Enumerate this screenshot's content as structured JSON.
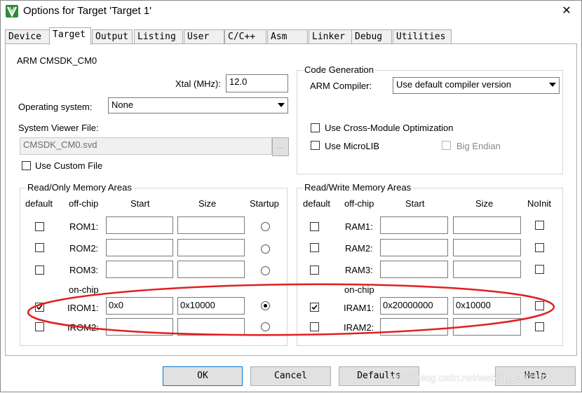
{
  "window": {
    "title": "Options for Target 'Target 1'",
    "close_glyph": "✕"
  },
  "tabs": [
    "Device",
    "Target",
    "Output",
    "Listing",
    "User",
    "C/C++",
    "Asm",
    "Linker",
    "Debug",
    "Utilities"
  ],
  "active_tab": "Target",
  "target": {
    "device_name": "ARM CMSDK_CM0",
    "xtal_label": "Xtal (MHz):",
    "xtal_value": "12.0",
    "os_label": "Operating system:",
    "os_value": "None",
    "svd_label": "System Viewer File:",
    "svd_value": "CMSDK_CM0.svd",
    "browse_label": "...",
    "custom_file_label": "Use Custom File"
  },
  "code_generation": {
    "title": "Code Generation",
    "compiler_label": "ARM Compiler:",
    "compiler_value": "Use default compiler version",
    "cross_module_label": "Use Cross-Module Optimization",
    "microlib_label": "Use MicroLIB",
    "big_endian_label": "Big Endian"
  },
  "rom_areas": {
    "title": "Read/Only Memory Areas",
    "headers": {
      "default": "default",
      "offchip": "off-chip",
      "start": "Start",
      "size": "Size",
      "startup": "Startup"
    },
    "onchip_label": "on-chip",
    "rows": [
      {
        "label": "ROM1:",
        "start": "",
        "size": "",
        "default_checked": false,
        "startup_selected": false
      },
      {
        "label": "ROM2:",
        "start": "",
        "size": "",
        "default_checked": false,
        "startup_selected": false
      },
      {
        "label": "ROM3:",
        "start": "",
        "size": "",
        "default_checked": false,
        "startup_selected": false
      },
      {
        "label": "IROM1:",
        "start": "0x0",
        "size": "0x10000",
        "default_checked": true,
        "startup_selected": true
      },
      {
        "label": "IROM2:",
        "start": "",
        "size": "",
        "default_checked": false,
        "startup_selected": false
      }
    ]
  },
  "ram_areas": {
    "title": "Read/Write Memory Areas",
    "headers": {
      "default": "default",
      "offchip": "off-chip",
      "start": "Start",
      "size": "Size",
      "noinit": "NoInit"
    },
    "onchip_label": "on-chip",
    "rows": [
      {
        "label": "RAM1:",
        "start": "",
        "size": "",
        "default_checked": false,
        "noinit_checked": false
      },
      {
        "label": "RAM2:",
        "start": "",
        "size": "",
        "default_checked": false,
        "noinit_checked": false
      },
      {
        "label": "RAM3:",
        "start": "",
        "size": "",
        "default_checked": false,
        "noinit_checked": false
      },
      {
        "label": "IRAM1:",
        "start": "0x20000000",
        "size": "0x10000",
        "default_checked": true,
        "noinit_checked": false
      },
      {
        "label": "IRAM2:",
        "start": "",
        "size": "",
        "default_checked": false,
        "noinit_checked": false
      }
    ]
  },
  "buttons": {
    "ok": "OK",
    "cancel": "Cancel",
    "defaults": "Defaults",
    "help": "Help"
  },
  "watermark": "https://blog.csdn.net/weixin_43772920",
  "colors": {
    "annotation_red": "#e02020",
    "focus_blue": "#0078d7",
    "app_icon_green": "#2e8b3a"
  }
}
